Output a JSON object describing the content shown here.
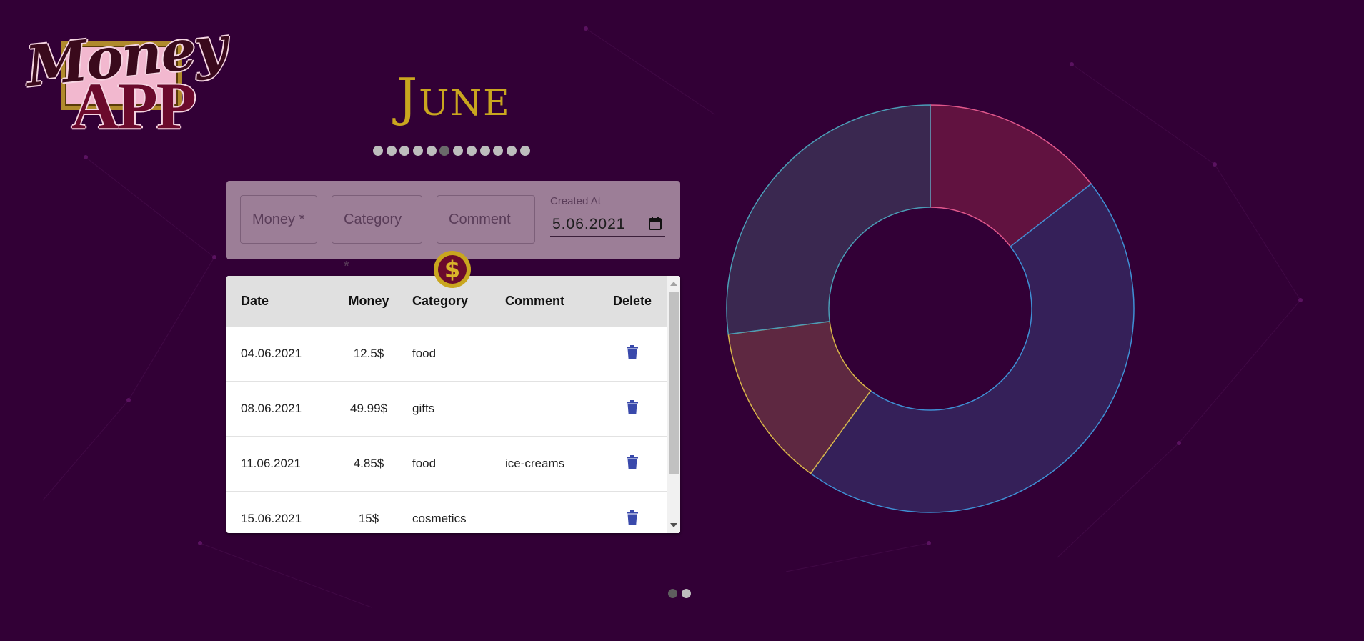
{
  "logo": {
    "line1": "Money",
    "line2": "APP"
  },
  "month": {
    "title": "June",
    "selector_count": 12,
    "active_index": 5
  },
  "form": {
    "money_placeholder": "Money *",
    "category_placeholder": "Category *",
    "comment_placeholder": "Comment",
    "date_label": "Created At",
    "date_value": "5.06.2021",
    "submit_icon": "dollar-coin-icon"
  },
  "table": {
    "headers": [
      "Date",
      "Money",
      "Category",
      "Comment",
      "Delete"
    ],
    "rows": [
      {
        "date": "04.06.2021",
        "money": "12.5$",
        "category": "food",
        "comment": ""
      },
      {
        "date": "08.06.2021",
        "money": "49.99$",
        "category": "gifts",
        "comment": ""
      },
      {
        "date": "11.06.2021",
        "money": "4.85$",
        "category": "food",
        "comment": "ice-creams"
      },
      {
        "date": "15.06.2021",
        "money": "15$",
        "category": "cosmetics",
        "comment": ""
      }
    ],
    "delete_icon": "trash-icon"
  },
  "chart_data": {
    "type": "pie",
    "donut": true,
    "segments": [
      {
        "value": 14.5,
        "fill": "#611240",
        "stroke": "#e0578c"
      },
      {
        "value": 45.5,
        "fill": "#352059",
        "stroke": "#3f8fd4"
      },
      {
        "value": 13.0,
        "fill": "#5e2841",
        "stroke": "#d8b449"
      },
      {
        "value": 27.0,
        "fill": "#3a2850",
        "stroke": "#4b9cb6"
      }
    ]
  },
  "pager": {
    "count": 2,
    "active_index": 0
  },
  "colors": {
    "background": "#320036",
    "accent_gold": "#c9a61f",
    "form_panel": "#9c7e97",
    "trash": "#3949ab"
  }
}
